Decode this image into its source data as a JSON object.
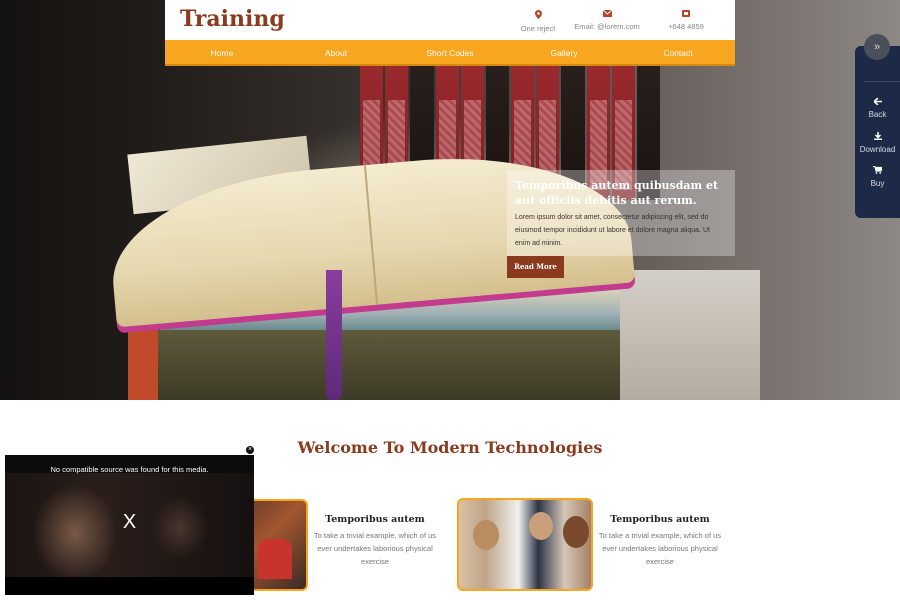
{
  "header": {
    "logo": "Training",
    "contacts": [
      {
        "icon": "map-marker-icon",
        "text": "One reject"
      },
      {
        "icon": "envelope-icon",
        "text": "Email: @lorem.com"
      },
      {
        "icon": "phone-icon",
        "text": "+648 4859"
      }
    ],
    "nav": [
      "Home",
      "About",
      "Short Codes",
      "Gallery",
      "Contact"
    ]
  },
  "hero": {
    "title": "Temporibus autem quibusdam et aut officiis debitis aut rerum.",
    "text": "Lorem ipsum dolor sit amet, consectetur adipiscing elit, sed do eiusmod tempor incididunt ut labore et dolore magna aliqua. Ut enim ad minim.",
    "button": "Read More"
  },
  "side_panel": {
    "toggle_icon": "»",
    "items": [
      {
        "icon": "arrow-left-icon",
        "label": "Back"
      },
      {
        "icon": "download-icon",
        "label": "Download"
      },
      {
        "icon": "cart-icon",
        "label": "Buy"
      }
    ]
  },
  "welcome": {
    "heading": "Welcome To Modern Technologies"
  },
  "cards": [
    {
      "title": "Temporibus autem",
      "text": "To take a trivial example, which of us ever undertakes laborious physical exercise"
    },
    {
      "title": "Temporibus autem",
      "text": "To take a trivial example, which of us ever undertakes laborious physical exercise"
    }
  ],
  "video": {
    "message": "No compatible source was found for this media.",
    "close_glyph": "X",
    "close_button": "×"
  },
  "colors": {
    "accent": "#f8a51f",
    "brand": "#8b3a1e",
    "panel": "#1d2a47"
  }
}
